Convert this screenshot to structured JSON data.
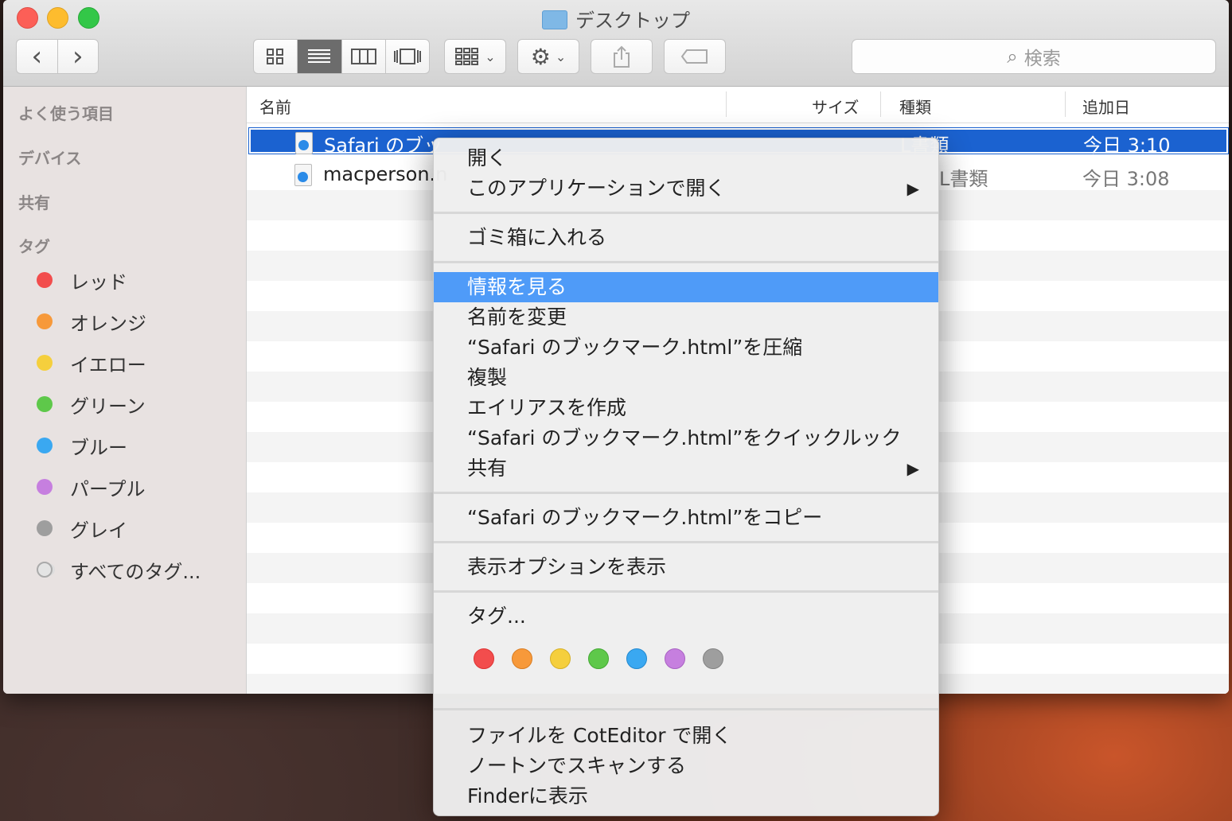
{
  "window": {
    "title": "デスクトップ"
  },
  "toolbar": {
    "back": "‹",
    "forward": "›",
    "views": [
      "icon-view",
      "list-view",
      "column-view",
      "coverflow-view"
    ],
    "search_placeholder": "検索"
  },
  "sidebar": {
    "headings": [
      "よく使う項目",
      "デバイス",
      "共有",
      "タグ"
    ],
    "tags": [
      {
        "label": "レッド",
        "color": "#f24d4d"
      },
      {
        "label": "オレンジ",
        "color": "#f7993a"
      },
      {
        "label": "イエロー",
        "color": "#f5cf3d"
      },
      {
        "label": "グリーン",
        "color": "#5ec84a"
      },
      {
        "label": "ブルー",
        "color": "#3aa8f1"
      },
      {
        "label": "パープル",
        "color": "#c67fdf"
      },
      {
        "label": "グレイ",
        "color": "#9e9e9e"
      },
      {
        "label": "すべてのタグ...",
        "color": "none"
      }
    ]
  },
  "list": {
    "columns": [
      "名前",
      "サイズ",
      "種類",
      "追加日"
    ],
    "rows": [
      {
        "name": "Safari のブッ",
        "size": "",
        "kind": "L書類",
        "date": "今日 3:10",
        "selected": true
      },
      {
        "name": "macperson.n",
        "size": "",
        "kind": "L書類",
        "date": "今日 3:08",
        "selected": false
      }
    ]
  },
  "menu": {
    "group1": [
      "開く",
      "このアプリケーションで開く"
    ],
    "group2": [
      "ゴミ箱に入れる"
    ],
    "group3": [
      "情報を見る",
      "名前を変更",
      "“Safari のブックマーク.html”を圧縮",
      "複製",
      "エイリアスを作成",
      "“Safari のブックマーク.html”をクイックルック",
      "共有"
    ],
    "group4": [
      "“Safari のブックマーク.html”をコピー"
    ],
    "group5": [
      "表示オプションを表示"
    ],
    "group6": [
      "タグ..."
    ],
    "tag_colors": [
      "#f24d4d",
      "#f7993a",
      "#f5cf3d",
      "#5ec84a",
      "#3aa8f1",
      "#c67fdf",
      "#9e9e9e"
    ],
    "group7": [
      "ファイルを CotEditor で開く",
      "ノートンでスキャンする",
      "Finderに表示"
    ],
    "submenu_arrow": "▶"
  }
}
